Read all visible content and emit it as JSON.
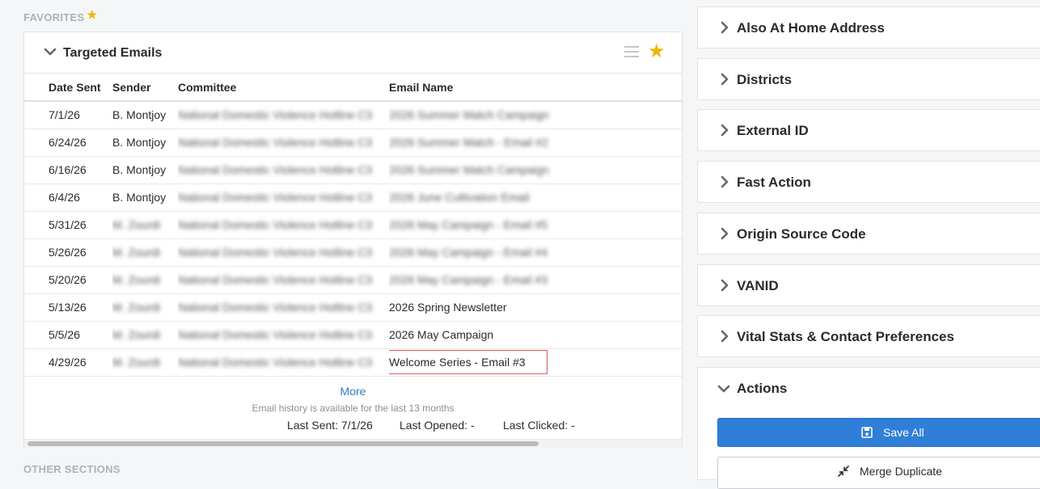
{
  "favorites": {
    "title": "FAVORITES"
  },
  "other_sections": {
    "title": "OTHER SECTIONS"
  },
  "targeted_emails": {
    "title": "Targeted Emails",
    "columns": [
      "Date Sent",
      "Sender",
      "Committee",
      "Email Name"
    ],
    "rows": [
      {
        "date": "7/1/26",
        "sender": "B. Montjoy",
        "committee": "National Domestic Violence Hotline C3",
        "email": "2026 Summer Match Campaign"
      },
      {
        "date": "6/24/26",
        "sender": "B. Montjoy",
        "committee": "National Domestic Violence Hotline C3",
        "email": "2026 Summer Match - Email #2"
      },
      {
        "date": "6/16/26",
        "sender": "B. Montjoy",
        "committee": "National Domestic Violence Hotline C3",
        "email": "2026 Summer Match Campaign"
      },
      {
        "date": "6/4/26",
        "sender": "B. Montjoy",
        "committee": "National Domestic Violence Hotline C3",
        "email": "2026 June Cultivation Email"
      },
      {
        "date": "5/31/26",
        "sender": "M. Zourdi",
        "committee": "National Domestic Violence Hotline C3",
        "email": "2026 May Campaign - Email #5"
      },
      {
        "date": "5/26/26",
        "sender": "M. Zourdi",
        "committee": "National Domestic Violence Hotline C3",
        "email": "2026 May Campaign - Email #4"
      },
      {
        "date": "5/20/26",
        "sender": "M. Zourdi",
        "committee": "National Domestic Violence Hotline C3",
        "email": "2026 May Campaign - Email #3"
      },
      {
        "date": "5/13/26",
        "sender": "M. Zourdi",
        "committee": "National Domestic Violence Hotline C3",
        "email": "2026 Spring Newsletter"
      },
      {
        "date": "5/5/26",
        "sender": "M. Zourdi",
        "committee": "National Domestic Violence Hotline C3",
        "email": "2026 May Campaign"
      },
      {
        "date": "4/29/26",
        "sender": "M. Zourdi",
        "committee": "National Domestic Violence Hotline C3",
        "email": "Welcome Series - Email #3"
      }
    ],
    "more_link": "More",
    "history_note": "Email history is available for the last 13 months",
    "last_sent": "Last Sent: 7/1/26",
    "last_opened": "Last Opened: -",
    "last_clicked": "Last Clicked: -"
  },
  "right_panels": [
    "Also At Home Address",
    "Districts",
    "External ID",
    "Fast Action",
    "Origin Source Code",
    "VANID",
    "Vital Stats & Contact Preferences"
  ],
  "actions": {
    "title": "Actions",
    "save_all": "Save All",
    "merge_duplicate": "Merge Duplicate"
  },
  "colors": {
    "accent_blue": "#2f7fd9",
    "star_gold": "#f0b400",
    "highlight_red": "#e05a5a"
  }
}
